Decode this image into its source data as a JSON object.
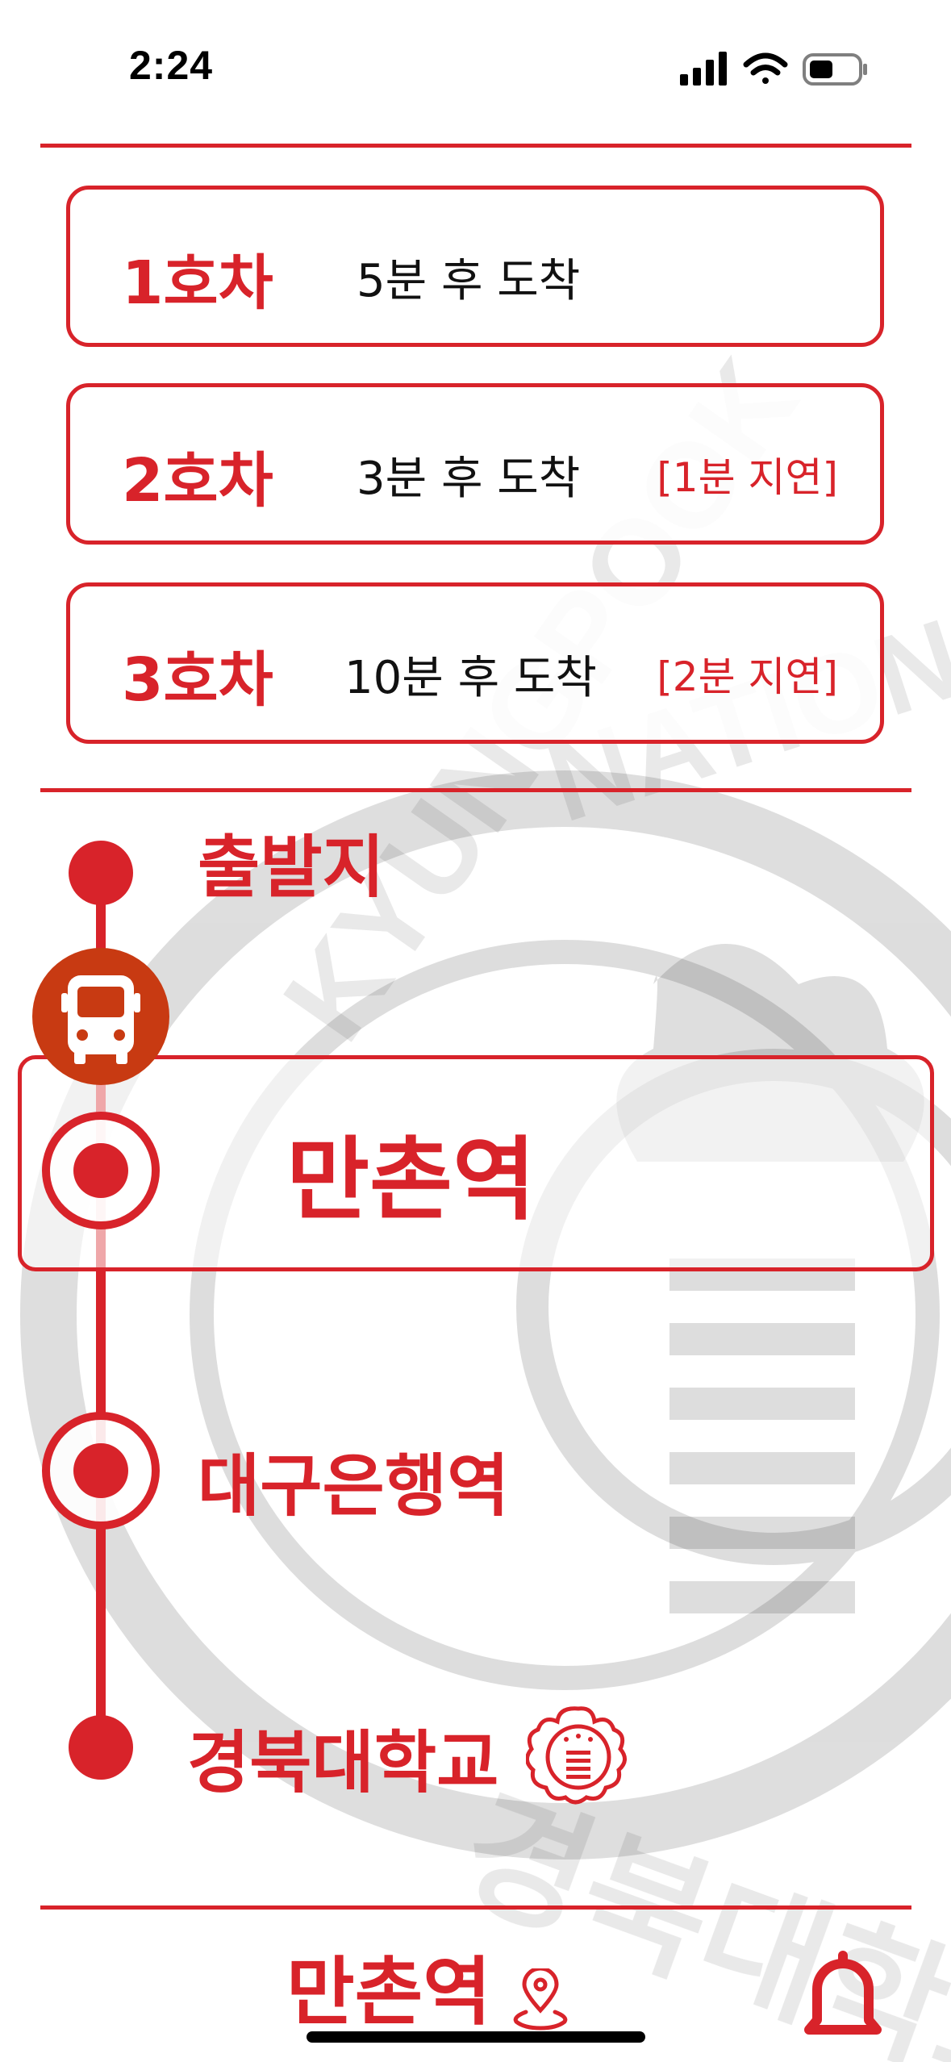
{
  "status_bar": {
    "time": "2:24"
  },
  "buses": [
    {
      "name": "1호차",
      "eta": "5분 후 도착",
      "delay": ""
    },
    {
      "name": "2호차",
      "eta": "3분 후 도착",
      "delay": "[1분 지연]"
    },
    {
      "name": "3호차",
      "eta": "10분 후 도착",
      "delay": "[2분 지연]"
    }
  ],
  "route": {
    "origin": "출발지",
    "current_stop": "만촌역",
    "next_stop": "대구은행역",
    "destination": "경북대학교"
  },
  "watermark_text": "KYUNGPOOK NATIONAL UNIVERSITY 경북대학교",
  "bottom_bar": {
    "station": "만촌역"
  },
  "colors": {
    "accent": "#d8232a",
    "bus_marker": "#c83a12"
  },
  "icons": {
    "bus": "bus-icon",
    "location": "location-pin-icon",
    "bell": "bell-icon",
    "emblem": "university-emblem-icon"
  }
}
